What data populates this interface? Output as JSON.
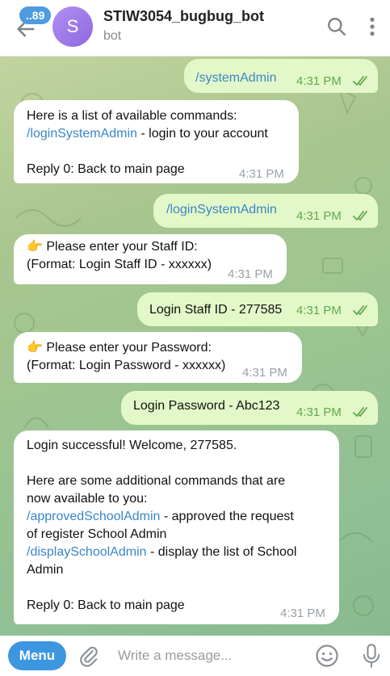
{
  "header": {
    "unread_badge": "..89",
    "avatar_letter": "S",
    "title": "STIW3054_bugbug_bot",
    "subtitle": "bot"
  },
  "messages": [
    {
      "dir": "out",
      "lines": [
        [
          "link",
          "/systemAdmin"
        ]
      ],
      "time": "4:31 PM",
      "read": true
    },
    {
      "dir": "in",
      "lines": [
        [
          "text",
          "Here is a list of available commands:"
        ],
        [
          "mixed",
          "/loginSystemAdmin",
          " - login to your account"
        ],
        [
          "blank",
          ""
        ],
        [
          "text",
          "Reply 0: Back to main page"
        ]
      ],
      "time": "4:31 PM"
    },
    {
      "dir": "out",
      "lines": [
        [
          "link",
          "/loginSystemAdmin"
        ]
      ],
      "time": "4:31 PM",
      "read": true
    },
    {
      "dir": "in",
      "lines": [
        [
          "text",
          "👉 Please enter your Staff ID:"
        ],
        [
          "text",
          "(Format: Login Staff ID - xxxxxx)"
        ]
      ],
      "time": "4:31 PM"
    },
    {
      "dir": "out",
      "lines": [
        [
          "text",
          "Login Staff ID - 277585"
        ]
      ],
      "time": "4:31 PM",
      "read": true
    },
    {
      "dir": "in",
      "lines": [
        [
          "text",
          "👉 Please enter your Password:"
        ],
        [
          "text",
          "(Format: Login Password - xxxxxx)"
        ]
      ],
      "time": "4:31 PM"
    },
    {
      "dir": "out",
      "lines": [
        [
          "text",
          "Login Password - Abc123"
        ]
      ],
      "time": "4:31 PM",
      "read": true
    },
    {
      "dir": "in",
      "lines": [
        [
          "text",
          "Login successful! Welcome, 277585."
        ],
        [
          "blank",
          ""
        ],
        [
          "text",
          "Here are some additional commands that are"
        ],
        [
          "text",
          "now available to you:"
        ],
        [
          "mixed",
          "/approvedSchoolAdmin",
          " - approved the request"
        ],
        [
          "text",
          "of register School Admin"
        ],
        [
          "mixed",
          "/displaySchoolAdmin",
          " - display the list of School"
        ],
        [
          "text",
          "Admin"
        ],
        [
          "blank",
          ""
        ],
        [
          "text",
          "Reply 0: Back to main page"
        ]
      ],
      "time": "4:31 PM"
    }
  ],
  "composer": {
    "menu_label": "Menu",
    "placeholder": "Write a message..."
  },
  "colors": {
    "accent": "#3d96e0",
    "link": "#3a86c8",
    "outgoing_bubble": "#e3f8c8",
    "incoming_bubble": "#ffffff",
    "check_color": "#5eaa4d"
  }
}
